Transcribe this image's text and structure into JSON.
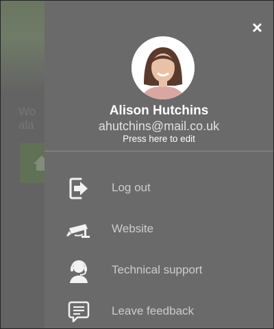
{
  "background": {
    "text_lines": [
      "Wo",
      "ala"
    ]
  },
  "drawer": {
    "close_label": "×",
    "profile": {
      "name": "Alison Hutchins",
      "email": "ahutchins@mail.co.uk",
      "edit_label": "Press here to edit"
    },
    "menu": [
      {
        "label": "Log out",
        "icon": "logout-icon"
      },
      {
        "label": "Website",
        "icon": "camera-icon"
      },
      {
        "label": "Technical support",
        "icon": "headset-icon"
      },
      {
        "label": "Leave feedback",
        "icon": "feedback-icon"
      }
    ]
  },
  "colors": {
    "drawer_bg": "#6a6a6a",
    "menu_label": "#cdcdcd",
    "icon": "#f2f2f2"
  }
}
